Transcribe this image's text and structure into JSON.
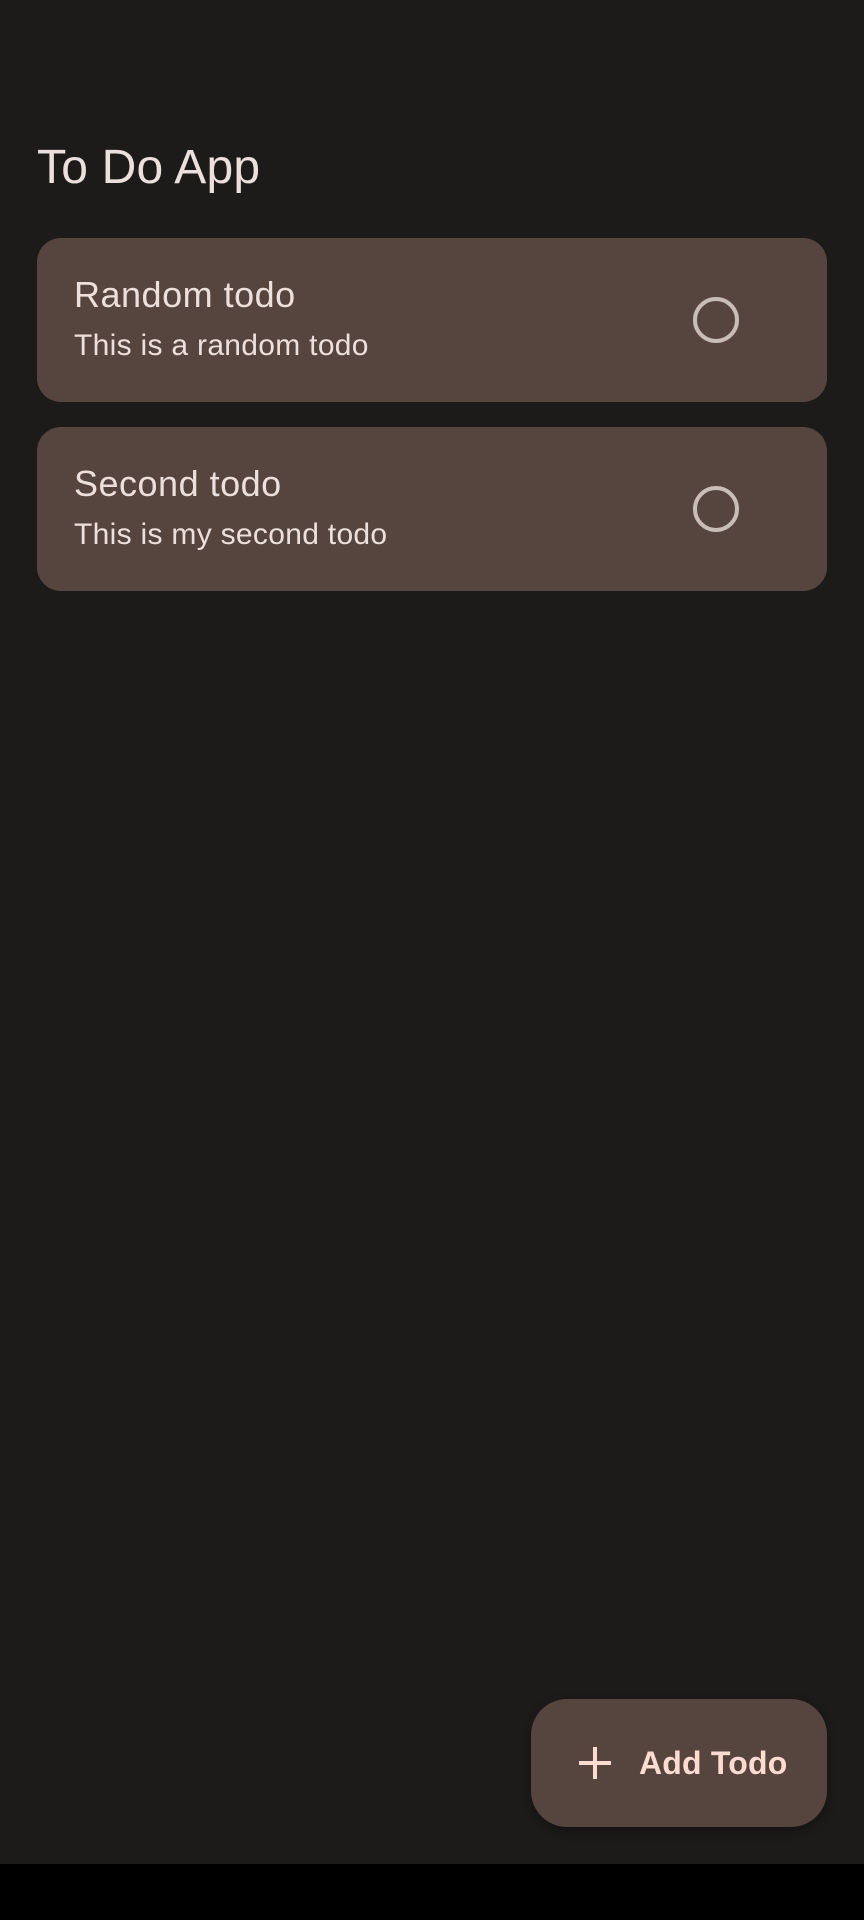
{
  "app": {
    "title": "To Do App"
  },
  "todos": [
    {
      "title": "Random todo",
      "description": "This is a random todo",
      "completed": false
    },
    {
      "title": "Second todo",
      "description": "This is my second todo",
      "completed": false
    }
  ],
  "fab": {
    "label": "Add Todo",
    "icon": "plus-icon"
  },
  "colors": {
    "background": "#1d1b1a",
    "card": "#56453f",
    "text": "#ede0dc",
    "fab_text": "#ffdbd0",
    "checkbox_border": "#c9bdb8",
    "nav_bar": "#000000"
  }
}
